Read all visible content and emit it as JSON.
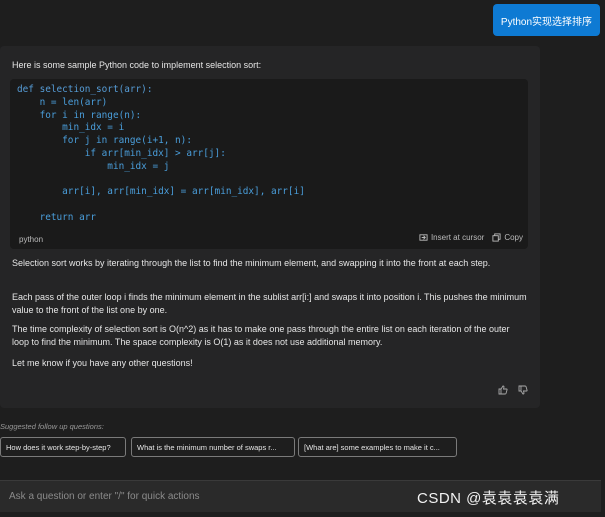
{
  "user_message": "Python实现选择排序",
  "answer": {
    "intro": "Here is some sample Python code to implement selection sort:",
    "code_language": "python",
    "code_lines": [
      "def selection_sort(arr):",
      "    n = len(arr)",
      "    for i in range(n):",
      "        min_idx = i",
      "        for j in range(i+1, n):",
      "            if arr[min_idx] > arr[j]:",
      "                min_idx = j",
      "",
      "        arr[i], arr[min_idx] = arr[min_idx], arr[i]",
      "",
      "    return arr"
    ],
    "insert_label": "Insert at cursor",
    "copy_label": "Copy",
    "paragraphs": [
      "Selection sort works by iterating through the list to find the minimum element, and swapping it into the front at each step.",
      "Each pass of the outer loop i finds the minimum element in the sublist arr[i:] and swaps it into position i. This pushes the minimum value to the front of the list one by one.",
      "The time complexity of selection sort is O(n^2) as it has to make one pass through the entire list on each iteration of the outer loop to find the minimum. The space complexity is O(1) as it does not use additional memory.",
      "Let me know if you have any other questions!"
    ]
  },
  "suggestions": {
    "label": "Suggested follow up questions:",
    "items": [
      "How does it work step-by-step?",
      "What is the minimum number of swaps r...",
      "[What are] some examples to make it c..."
    ]
  },
  "input": {
    "placeholder": "Ask a question or enter \"/\" for quick actions"
  },
  "watermark": "CSDN @袁袁袁袁满",
  "colors": {
    "accent": "#0e7ad3",
    "background": "#1e1e1e",
    "card": "#252526",
    "code_bg": "#1a1a1a"
  }
}
